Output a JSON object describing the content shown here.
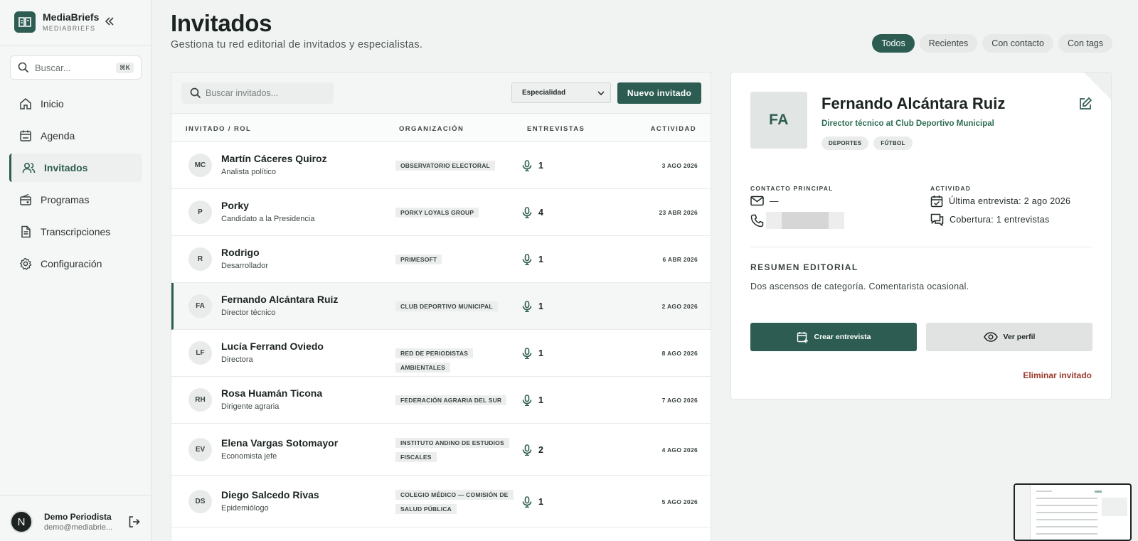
{
  "brand": {
    "name": "MediaBriefs",
    "sub": "MEDIABRIEFS"
  },
  "search": {
    "placeholder": "Buscar...",
    "shortcut": "⌘K"
  },
  "nav": [
    {
      "label": "Inicio",
      "icon": "home-icon"
    },
    {
      "label": "Agenda",
      "icon": "calendar-icon"
    },
    {
      "label": "Invitados",
      "icon": "users-icon",
      "active": true
    },
    {
      "label": "Programas",
      "icon": "radio-icon"
    },
    {
      "label": "Transcripciones",
      "icon": "document-icon"
    },
    {
      "label": "Configuración",
      "icon": "gear-icon"
    }
  ],
  "user": {
    "initial": "N",
    "name": "Demo Periodista",
    "email": "demo@mediabrie..."
  },
  "header": {
    "title": "Invitados",
    "subtitle": "Gestiona tu red editorial de invitados y especialistas."
  },
  "filters": [
    {
      "label": "Todos",
      "active": true
    },
    {
      "label": "Recientes"
    },
    {
      "label": "Con contacto"
    },
    {
      "label": "Con tags"
    }
  ],
  "list": {
    "search_placeholder": "Buscar invitados...",
    "specialty_label": "Especialidad",
    "new_button": "Nuevo invitado",
    "columns": {
      "guest": "INVITADO / ROL",
      "org": "ORGANIZACIÓN",
      "interviews": "ENTREVISTAS",
      "activity": "ACTIVIDAD"
    },
    "rows": [
      {
        "initials": "MC",
        "name": "Martín Cáceres Quiroz",
        "role": "Analista político",
        "org": "OBSERVATORIO ELECTORAL",
        "interviews": "1",
        "date": "3 AGO 2026"
      },
      {
        "initials": "P",
        "name": "Porky",
        "role": "Candidato a la Presidencia",
        "org": "PORKY LOYALS GROUP",
        "interviews": "4",
        "date": "23 ABR 2026"
      },
      {
        "initials": "R",
        "name": "Rodrigo",
        "role": "Desarrollador",
        "org": "PRIMESOFT",
        "interviews": "1",
        "date": "6 ABR 2026"
      },
      {
        "initials": "FA",
        "name": "Fernando Alcántara Ruiz",
        "role": "Director técnico",
        "org": "CLUB DEPORTIVO MUNICIPAL",
        "interviews": "1",
        "date": "2 AGO 2026",
        "selected": true
      },
      {
        "initials": "LF",
        "name": "Lucía Ferrand Oviedo",
        "role": "Directora",
        "org": "RED DE PERIODISTAS AMBIENTALES",
        "interviews": "1",
        "date": "8 AGO 2026"
      },
      {
        "initials": "RH",
        "name": "Rosa Huamán Ticona",
        "role": "Dirigente agraria",
        "org": "FEDERACIÓN AGRARIA DEL SUR",
        "interviews": "1",
        "date": "7 AGO 2026"
      },
      {
        "initials": "EV",
        "name": "Elena Vargas Sotomayor",
        "role": "Economista jefe",
        "org": "INSTITUTO ANDINO DE ESTUDIOS FISCALES",
        "interviews": "2",
        "date": "4 AGO 2026"
      },
      {
        "initials": "DS",
        "name": "Diego Salcedo Rivas",
        "role": "Epidemiólogo",
        "org": "COLEGIO MÉDICO — COMISIÓN DE SALUD PÚBLICA",
        "interviews": "1",
        "date": "5 AGO 2026"
      }
    ]
  },
  "detail": {
    "initials": "FA",
    "name": "Fernando Alcántara Ruiz",
    "role": "Director técnico at Club Deportivo Municipal",
    "tags": [
      "DEPORTES",
      "FÚTBOL"
    ],
    "contact_label": "CONTACTO PRINCIPAL",
    "email": "—",
    "activity_label": "ACTIVIDAD",
    "last_interview": "Última entrevista: 2 ago 2026",
    "coverage": "Cobertura: 1 entrevistas",
    "summary_label": "RESUMEN EDITORIAL",
    "summary": "Dos ascensos de categoría. Comentarista ocasional.",
    "create_button": "Crear entrevista",
    "profile_button": "Ver perfil",
    "delete_link": "Eliminar invitado"
  },
  "colors": {
    "accent": "#2d5d52",
    "danger": "#9a3a2c",
    "accent_text": "#2d6e54"
  }
}
